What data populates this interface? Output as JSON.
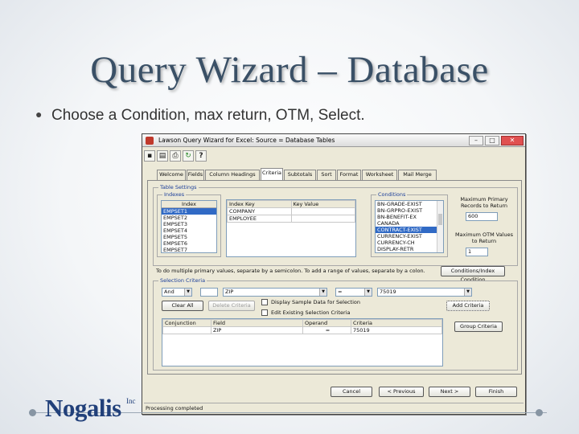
{
  "slide": {
    "title": "Query Wizard – Database",
    "bullet": "Choose a Condition, max return, OTM, Select."
  },
  "window": {
    "title": "Lawson Query Wizard for Excel: Source = Database Tables",
    "toolbar_icons": [
      "save-icon",
      "query-icon",
      "print-icon",
      "refresh-icon",
      "help-icon"
    ],
    "help_glyph": "?",
    "tabs": [
      {
        "label": "Welcome"
      },
      {
        "label": "Fields"
      },
      {
        "label": "Column Headings"
      },
      {
        "label": "Criteria"
      },
      {
        "label": "Subtotals"
      },
      {
        "label": "Sort"
      },
      {
        "label": "Format"
      },
      {
        "label": "Worksheet"
      },
      {
        "label": "Mail Merge"
      }
    ],
    "active_tab": "Criteria",
    "table_settings": {
      "label": "Table Settings",
      "indexes": {
        "label": "Indexes",
        "header": "Index",
        "items": [
          "EMPSET1",
          "EMPSET2",
          "EMPSET3",
          "EMPSET4",
          "EMPSET5",
          "EMPSET6",
          "EMPSET7"
        ],
        "selected": "EMPSET1"
      },
      "index_keys": {
        "columns": [
          "Index Key",
          "Key Value"
        ],
        "rows": [
          [
            "COMPANY",
            ""
          ],
          [
            "EMPLOYEE",
            ""
          ]
        ]
      },
      "conditions": {
        "label": "Conditions",
        "items": [
          "BN-GRADE-EXIST",
          "BN-GRPRO-EXIST",
          "BN-BENEFIT-EX",
          "CANADA",
          "CONTRACT-EXIST",
          "CURRENCY-EXIST",
          "CURRENCY-CH",
          "DISPLAY-RETR"
        ],
        "selected": "CONTRACT-EXIST"
      },
      "max_records_label": "Maximum Primary Records to Return",
      "max_records_value": "600",
      "max_otm_label": "Maximum OTM Values to Return",
      "max_otm_value": "1"
    },
    "multi_values_note": "To do multiple primary values, separate by a semicolon. To add a range of values, separate by a colon.",
    "conditions_button": "Conditions/Index Condition",
    "selection_criteria": {
      "label": "Selection Criteria",
      "conjunction": "And",
      "field": "ZIP",
      "operand": "=",
      "value": "75019",
      "clear_all": "Clear All",
      "delete_criteria": "Delete Criteria",
      "sample_data_label": "Display Sample Data for Selection",
      "edit_existing_label": "Edit Existing Selection Criteria",
      "add_criteria": "Add Criteria",
      "grid_columns": [
        "Conjunction",
        "Field",
        "Operand",
        "Criteria"
      ],
      "grid_rows": [
        [
          "",
          "ZIP",
          "=",
          "75019"
        ]
      ],
      "group_criteria": "Group Criteria"
    },
    "buttons": {
      "cancel": "Cancel",
      "previous": "< Previous",
      "next": "Next >",
      "finish": "Finish"
    },
    "status": "Processing completed"
  },
  "footer": {
    "logo_name": "Nogalis",
    "logo_suffix": "Inc"
  }
}
